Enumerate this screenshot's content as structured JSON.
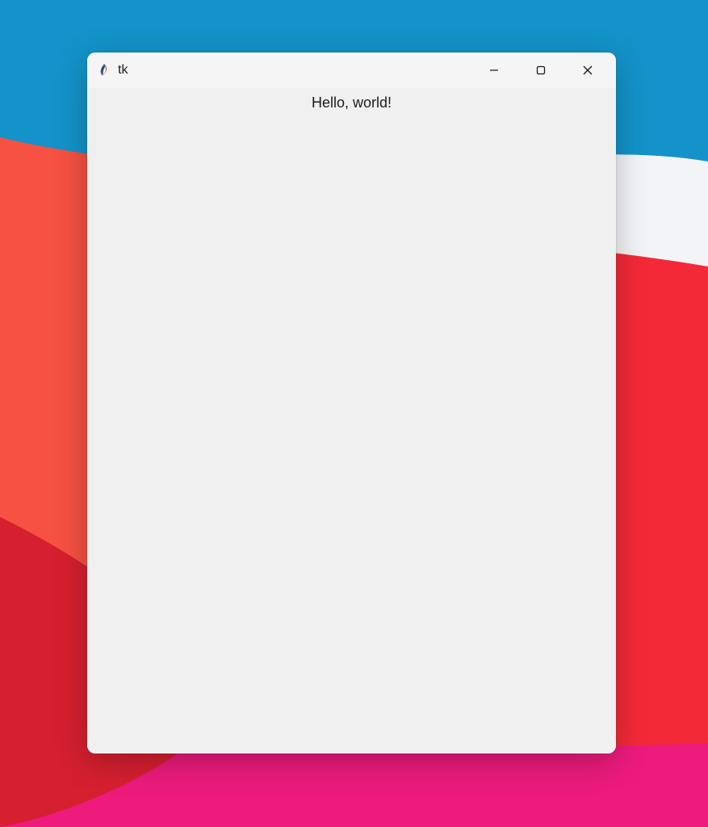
{
  "window": {
    "title": "tk",
    "content": {
      "label": "Hello, world!"
    }
  }
}
